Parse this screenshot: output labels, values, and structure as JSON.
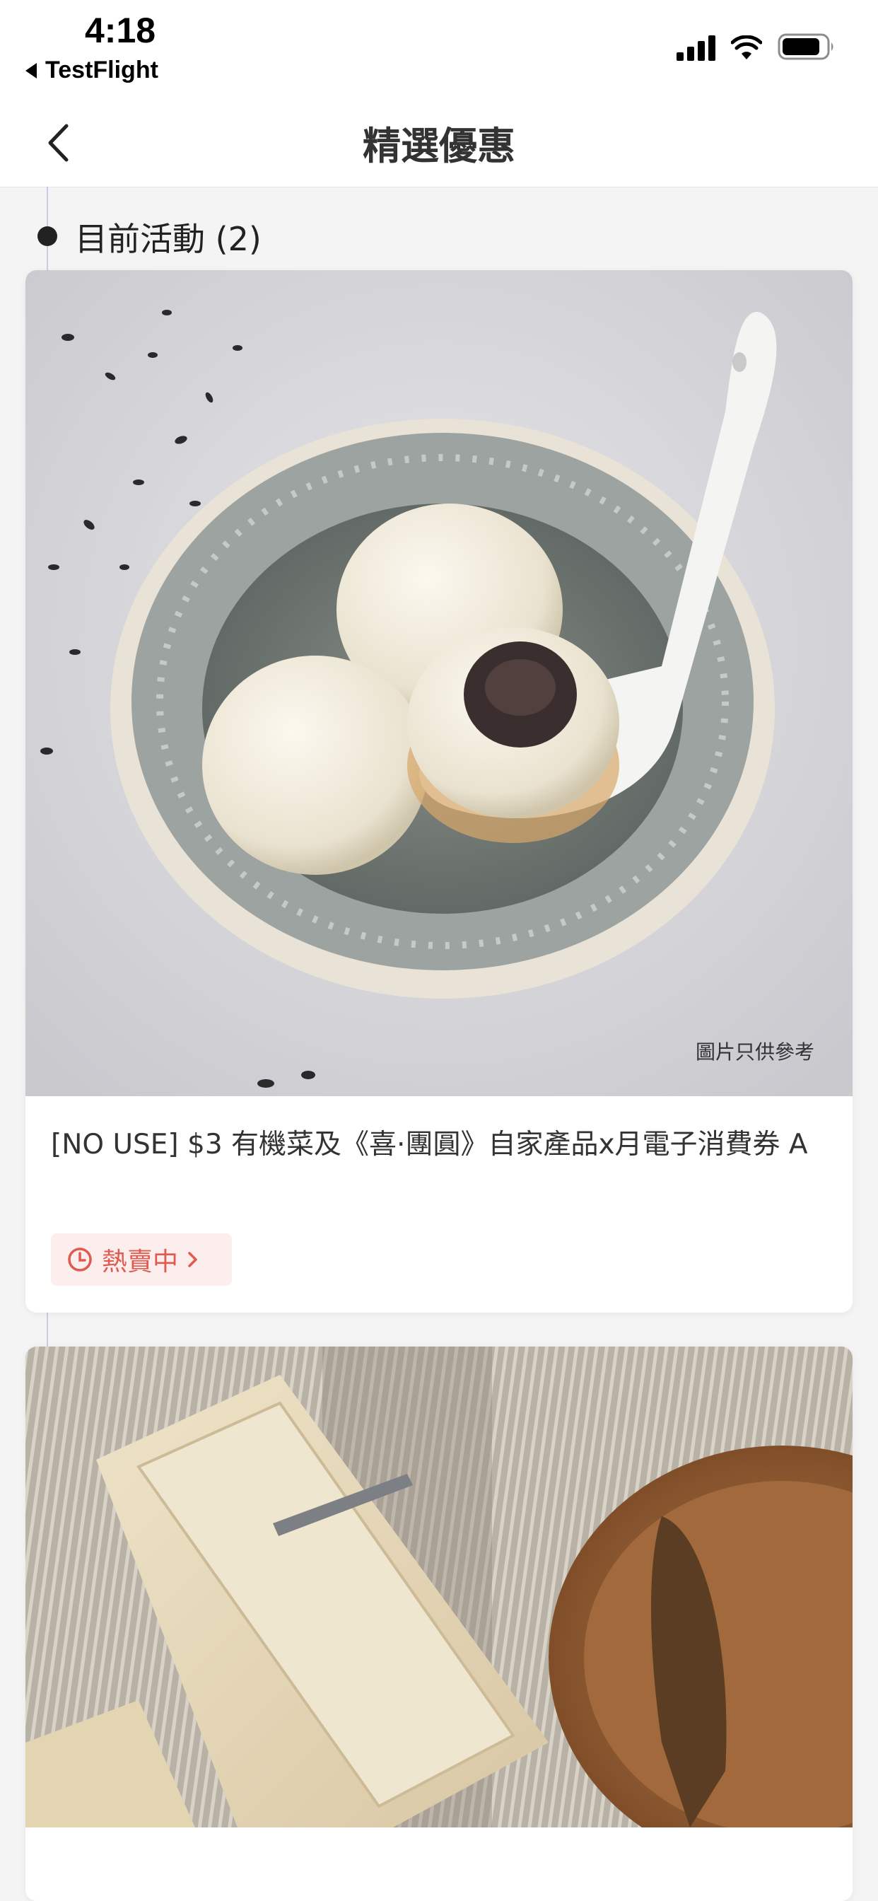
{
  "status_bar": {
    "time": "4:18",
    "back_app": "TestFlight"
  },
  "nav": {
    "title": "精選優惠"
  },
  "section": {
    "title": "目前活動 (2)"
  },
  "cards": [
    {
      "image_note": "圖片只供參考",
      "title": "[NO USE] $3 有機菜及《喜·團圓》自家產品x月電子消費券 A",
      "status": "熱賣中"
    }
  ],
  "colors": {
    "accent_red": "#e05a4e",
    "pill_bg": "#fdeeee",
    "timeline": "#c9cce8"
  }
}
